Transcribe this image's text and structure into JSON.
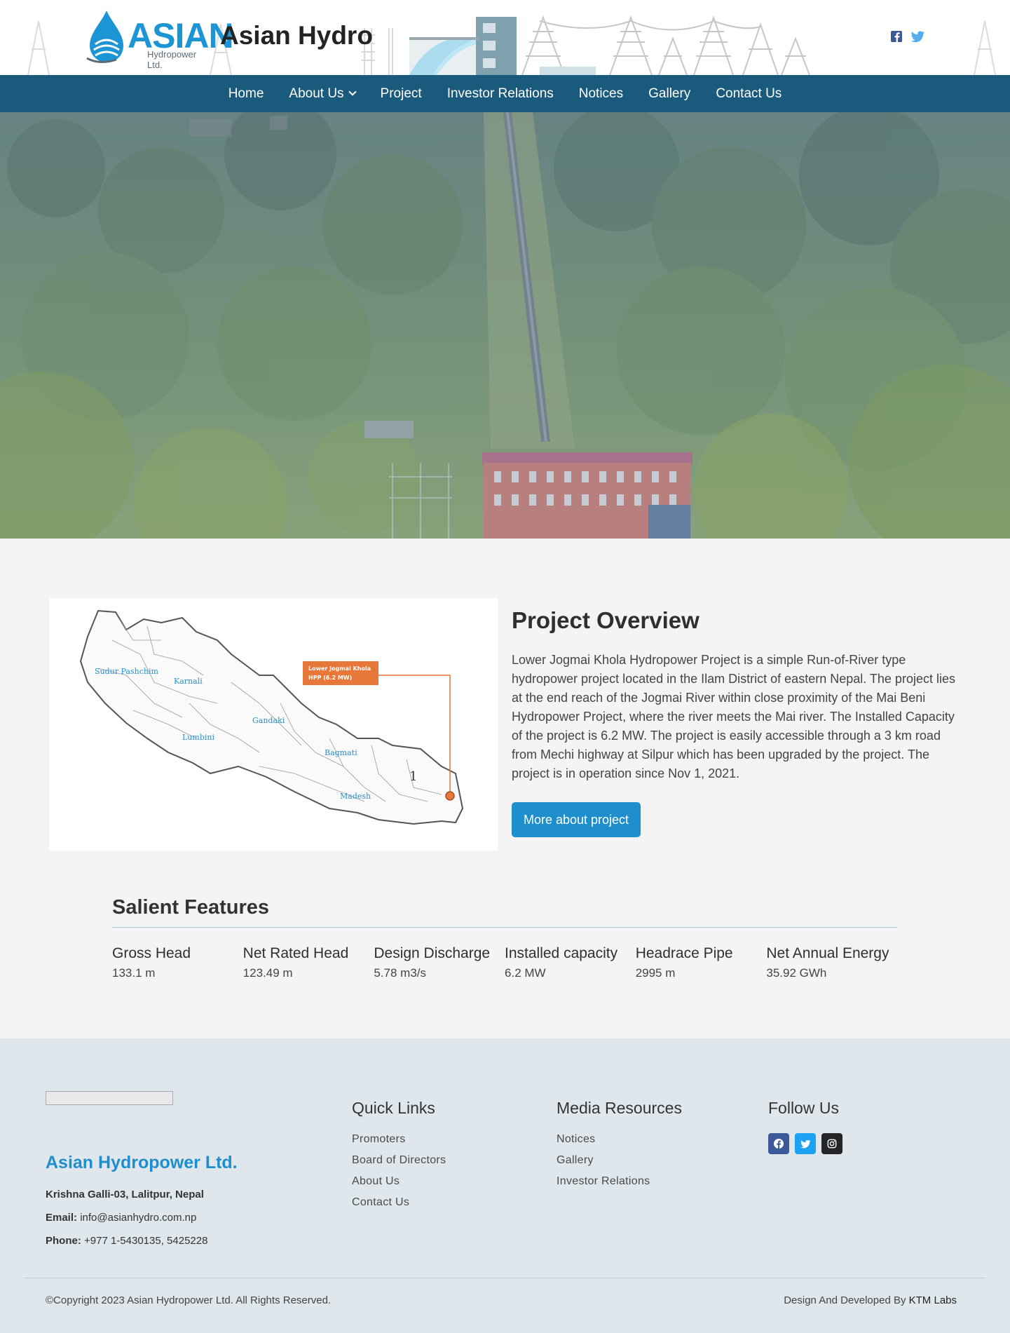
{
  "header": {
    "logo_word": "ASIAN",
    "logo_sub": "Hydropower Ltd.",
    "site_title": "Asian Hydro",
    "social_icons": [
      "facebook-icon",
      "twitter-icon"
    ]
  },
  "nav": {
    "items": [
      "Home",
      "About Us",
      "Project",
      "Investor Relations",
      "Notices",
      "Gallery",
      "Contact Us"
    ]
  },
  "overview": {
    "title": "Project Overview",
    "body": "Lower Jogmai Khola Hydropower Project is a simple Run-of-River type hydropower project located in the Ilam District of eastern Nepal. The project lies at the end reach of the Jogmai River within close proximity of the Mai Beni Hydropower Project, where the river meets the Mai river. The Installed Capacity of the project is 6.2 MW. The project is easily accessible through a 3 km road from Mechi highway at Silpur which has been upgraded by the project. The project is in operation since Nov 1, 2021.",
    "button": "More about project",
    "map": {
      "callout_line1": "Lower Jogmai Khola",
      "callout_line2": "HPP (6.2 MW)",
      "regions": [
        "Sudur Pashchim",
        "Karnali",
        "Gandaki",
        "Lumbini",
        "Bagmati",
        "Madesh"
      ],
      "province_number": "1"
    }
  },
  "salient": {
    "title": "Salient Features",
    "features": [
      {
        "label": "Gross Head",
        "value": "133.1 m"
      },
      {
        "label": "Net Rated Head",
        "value": "123.49 m"
      },
      {
        "label": "Design Discharge",
        "value": "5.78 m3/s"
      },
      {
        "label": "Installed capacity",
        "value": "6.2 MW"
      },
      {
        "label": "Headrace Pipe",
        "value": "2995 m"
      },
      {
        "label": "Net Annual Energy",
        "value": "35.92 GWh"
      }
    ]
  },
  "footer": {
    "company": "Asian Hydropower Ltd.",
    "address": "Krishna Galli-03, Lalitpur, Nepal",
    "email_label": "Email:",
    "email": "info@asianhydro.com.np",
    "phone_label": "Phone:",
    "phone": "+977 1-5430135, 5425228",
    "quick_links": {
      "title": "Quick Links",
      "items": [
        "Promoters",
        "Board of Directors",
        "About Us",
        "Contact Us"
      ]
    },
    "media": {
      "title": "Media Resources",
      "items": [
        "Notices",
        "Gallery",
        "Investor Relations"
      ]
    },
    "follow": {
      "title": "Follow Us",
      "icons": [
        "facebook-icon",
        "twitter-icon",
        "instagram-icon"
      ]
    },
    "copyright": "©Copyright 2023 Asian Hydropower Ltd. All Rights Reserved.",
    "credit_prefix": "Design And Developed By",
    "credit_name": "KTM Labs"
  },
  "colors": {
    "brand_blue": "#1e8fcc",
    "nav_bg": "#1a5a7c",
    "footer_bg": "#dfe7ec"
  }
}
